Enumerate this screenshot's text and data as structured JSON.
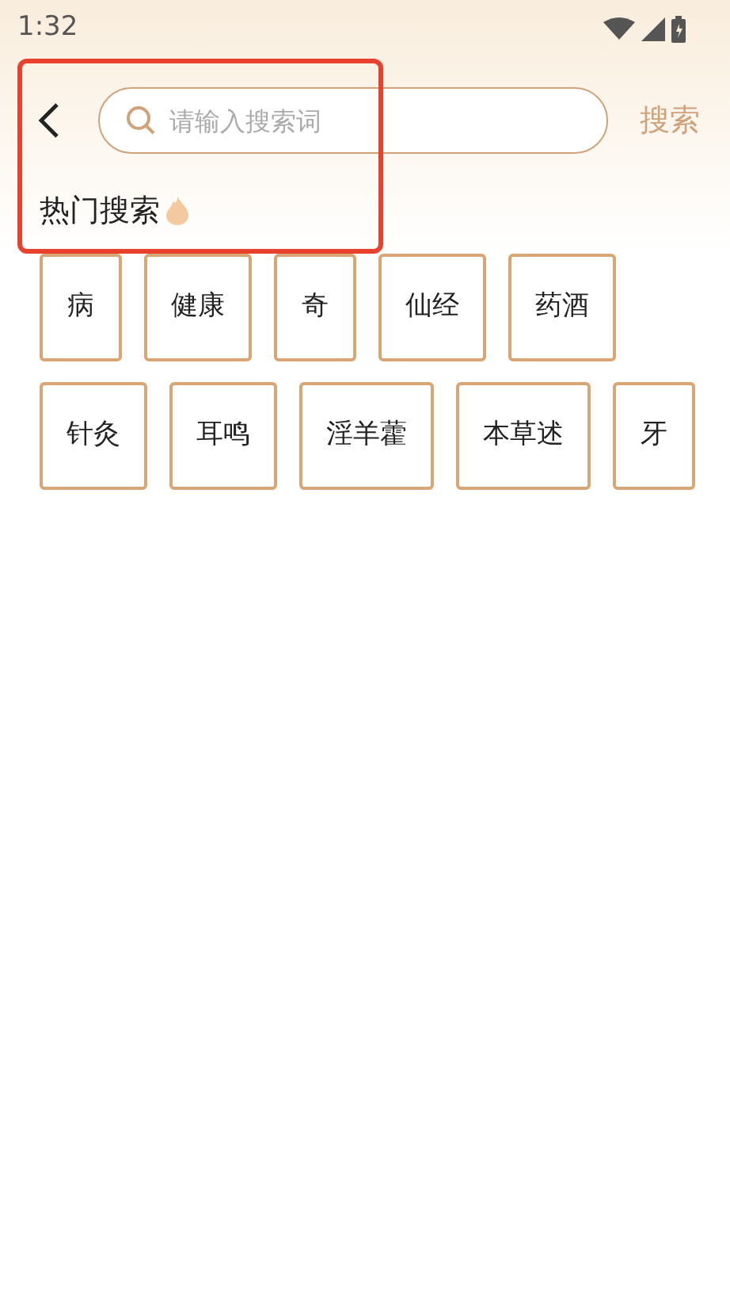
{
  "status_bar": {
    "time": "1:32"
  },
  "search": {
    "placeholder": "请输入搜索词",
    "button": "搜索"
  },
  "hot_search": {
    "title": "热门搜索",
    "rows": [
      [
        "病",
        "健康",
        "奇",
        "仙经",
        "药酒"
      ],
      [
        "针灸",
        "耳鸣",
        "淫羊藿",
        "本草述",
        "牙"
      ]
    ]
  }
}
